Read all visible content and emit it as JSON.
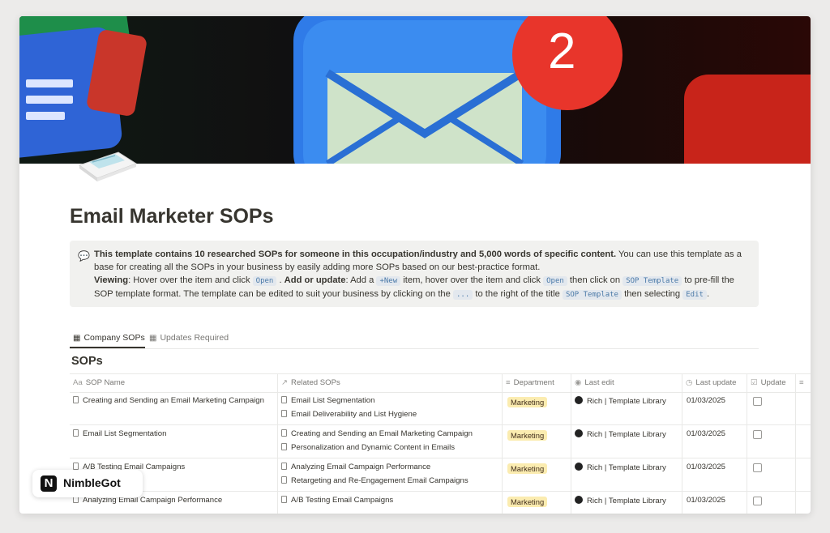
{
  "page": {
    "title": "Email Marketer SOPs",
    "cover_badge_number": "2"
  },
  "callout": {
    "icon": "speech-balloon-icon",
    "bold_intro": "This template contains 10 researched SOPs for someone in this occupation/industry and 5,000 words of specific content.",
    "intro_rest": " You can use this template as a base for creating all the SOPs in your business by easily adding more SOPs based on our best-practice format.",
    "viewing_label": "Viewing",
    "viewing_text": ": Hover over the item and click ",
    "code_open": "Open",
    "add_label": "Add or update",
    "add_text_1": ": Add a ",
    "code_new": "+New",
    "add_text_2": " item, hover over the item and click ",
    "add_text_3": " then click on ",
    "code_sop_template": "SOP Template",
    "add_text_4": " to pre-fill the SOP template format. The template can be edited to suit your business by clicking on the ",
    "code_dots": "...",
    "add_text_5": " to the right of the title ",
    "add_text_6": " then selecting ",
    "code_edit": "Edit",
    "add_text_7": "."
  },
  "tabs": [
    {
      "label": "Company SOPs",
      "active": true
    },
    {
      "label": "Updates Required",
      "active": false
    }
  ],
  "database": {
    "title": "SOPs",
    "columns": [
      {
        "label": "SOP Name",
        "icon": "Aa"
      },
      {
        "label": "Related SOPs",
        "icon": "↗"
      },
      {
        "label": "Department",
        "icon": "≡"
      },
      {
        "label": "Last edit",
        "icon": "user-icon"
      },
      {
        "label": "Last update",
        "icon": "clock-icon"
      },
      {
        "label": "Update",
        "icon": "checkbox-icon"
      }
    ],
    "rows": [
      {
        "name": "Creating and Sending an Email Marketing Campaign",
        "related": [
          "Email List Segmentation",
          "Email Deliverability and List Hygiene"
        ],
        "department": "Marketing",
        "last_edit": "Rich | Template Library",
        "last_update": "01/03/2025"
      },
      {
        "name": "Email List Segmentation",
        "related": [
          "Creating and Sending an Email Marketing Campaign",
          "Personalization and Dynamic Content in Emails"
        ],
        "department": "Marketing",
        "last_edit": "Rich | Template Library",
        "last_update": "01/03/2025"
      },
      {
        "name": "A/B Testing Email Campaigns",
        "related": [
          "Analyzing Email Campaign Performance",
          "Retargeting and Re-Engagement Email Campaigns"
        ],
        "department": "Marketing",
        "last_edit": "Rich | Template Library",
        "last_update": "01/03/2025"
      },
      {
        "name": "Analyzing Email Campaign Performance",
        "related": [
          "A/B Testing Email Campaigns"
        ],
        "department": "Marketing",
        "last_edit": "Rich | Template Library",
        "last_update": "01/03/2025"
      }
    ]
  },
  "brand": {
    "mark": "N",
    "name": "NimbleGot"
  },
  "colors": {
    "marketing_badge": "#fbecb0",
    "code_bg": "#e3e8ee",
    "notification_red": "#e8352b"
  }
}
